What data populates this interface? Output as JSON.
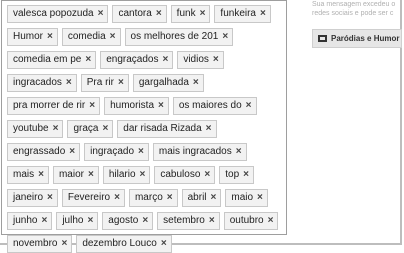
{
  "tags": [
    {
      "label": "valesca popozuda"
    },
    {
      "label": "cantora"
    },
    {
      "label": "funk"
    },
    {
      "label": "funkeira"
    },
    {
      "label": "Humor"
    },
    {
      "label": "comedia"
    },
    {
      "label": "os melhores de 201"
    },
    {
      "label": "comedia em pe"
    },
    {
      "label": "engraçados"
    },
    {
      "label": "vidios"
    },
    {
      "label": "ingracados"
    },
    {
      "label": "Pra rir"
    },
    {
      "label": "gargalhada"
    },
    {
      "label": "pra morrer de rir"
    },
    {
      "label": "humorista"
    },
    {
      "label": "os maiores do"
    },
    {
      "label": "youtube"
    },
    {
      "label": "graça"
    },
    {
      "label": "dar risada Rizada"
    },
    {
      "label": "engrassado"
    },
    {
      "label": "ingraçado"
    },
    {
      "label": "mais ingracados"
    },
    {
      "label": "mais"
    },
    {
      "label": "maior"
    },
    {
      "label": "hilario"
    },
    {
      "label": "cabuloso"
    },
    {
      "label": "top"
    },
    {
      "label": "janeiro"
    },
    {
      "label": "Fevereiro"
    },
    {
      "label": "março"
    },
    {
      "label": "abril"
    },
    {
      "label": "maio"
    },
    {
      "label": "junho"
    },
    {
      "label": "julho"
    },
    {
      "label": "agosto"
    },
    {
      "label": "setembro"
    },
    {
      "label": "outubro"
    },
    {
      "label": "novembro"
    },
    {
      "label": "dezembro Louco"
    }
  ],
  "remove_glyph": "×",
  "side_notice": "Sua mensagem excedeu o redes sociais e pode ser c",
  "category_chip": {
    "label": "Paródias e Humor",
    "icon": "film-icon"
  }
}
